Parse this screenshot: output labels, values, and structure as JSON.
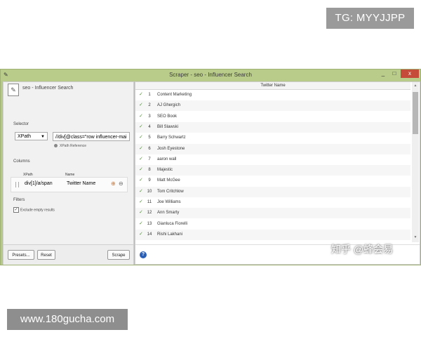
{
  "watermarks": {
    "top": "TG: MYYJJPP",
    "bottom": "www.180gucha.com",
    "zhihu": "知乎 @蜂会易"
  },
  "window": {
    "title": "Scraper - seo - Influencer Search",
    "buttons": {
      "minimize": "_",
      "maximize": "□",
      "close": "x"
    }
  },
  "left": {
    "header": "seo - Influencer Search",
    "selector_label": "Selector",
    "selector_type": "XPath",
    "xpath_value": "//div[@class=\"row influencer-mai",
    "xpath_reference": "XPath Reference",
    "columns_label": "Columns",
    "col_headers": {
      "xpath": "XPath",
      "name": "Name"
    },
    "column": {
      "xpath": "div[1]/a/span",
      "name": "Twitter Name"
    },
    "filters_label": "Filters",
    "exclude_empty": "Exclude empty results",
    "buttons": {
      "presets": "Presets...",
      "reset": "Reset",
      "scrape": "Scrape"
    }
  },
  "right": {
    "column_header": "Twitter Name",
    "rows": [
      {
        "num": "1",
        "value": "Content Marketing"
      },
      {
        "num": "2",
        "value": "AJ Ghergich"
      },
      {
        "num": "3",
        "value": "SEO Book"
      },
      {
        "num": "4",
        "value": "Bill Slawski"
      },
      {
        "num": "5",
        "value": "Barry Schwartz"
      },
      {
        "num": "6",
        "value": "Josh Eyestone"
      },
      {
        "num": "7",
        "value": "aaron wall"
      },
      {
        "num": "8",
        "value": "Majestic"
      },
      {
        "num": "9",
        "value": "Matt McGee"
      },
      {
        "num": "10",
        "value": "Tom Critchlow"
      },
      {
        "num": "11",
        "value": "Joe Williams"
      },
      {
        "num": "12",
        "value": "Ann Smarty"
      },
      {
        "num": "13",
        "value": "Gianluca Fiorelli"
      },
      {
        "num": "14",
        "value": "Rishi Lakhani"
      }
    ],
    "help": "?"
  },
  "colors": {
    "titlebar": "#b9cc8a",
    "close": "#c54a3a",
    "check": "#4c9b2a"
  }
}
